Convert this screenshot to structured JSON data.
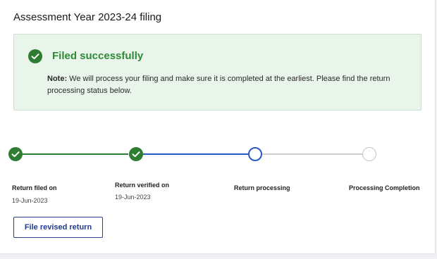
{
  "header": {
    "title": "Assessment Year 2023-24 filing"
  },
  "alert": {
    "icon": "check-circle-icon",
    "heading": "Filed successfully",
    "note_label": "Note:",
    "note_text": " We will process your filing and make sure it is completed at the earliest. Please find the return processing status below."
  },
  "steps": [
    {
      "label": "Return filed on",
      "date": "19-Jun-2023",
      "status": "done"
    },
    {
      "label": "Return verified on",
      "date": "19-Jun-2023",
      "status": "done"
    },
    {
      "label": "Return processing",
      "date": "",
      "status": "current"
    },
    {
      "label": "Processing Completion",
      "date": "",
      "status": "pending"
    }
  ],
  "actions": {
    "revise_label": "File revised return"
  },
  "colors": {
    "success": "#2e7d32",
    "active": "#2b59c3",
    "pending": "#cfcfcf",
    "alert_bg": "#e9f4ea",
    "button_border": "#2a3f8f"
  }
}
